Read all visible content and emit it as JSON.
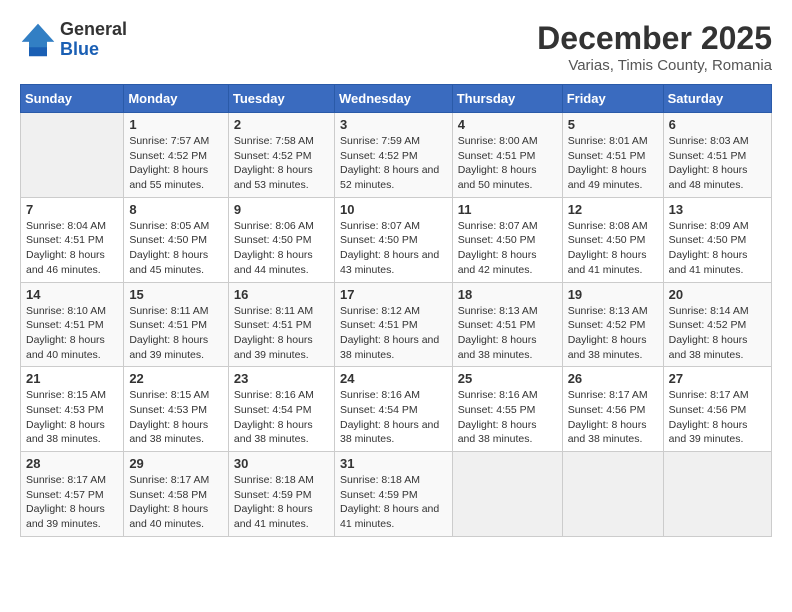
{
  "header": {
    "logo_line1": "General",
    "logo_line2": "Blue",
    "title": "December 2025",
    "subtitle": "Varias, Timis County, Romania"
  },
  "days_of_week": [
    "Sunday",
    "Monday",
    "Tuesday",
    "Wednesday",
    "Thursday",
    "Friday",
    "Saturday"
  ],
  "weeks": [
    [
      {
        "num": "",
        "sunrise": "",
        "sunset": "",
        "daylight": ""
      },
      {
        "num": "1",
        "sunrise": "Sunrise: 7:57 AM",
        "sunset": "Sunset: 4:52 PM",
        "daylight": "Daylight: 8 hours and 55 minutes."
      },
      {
        "num": "2",
        "sunrise": "Sunrise: 7:58 AM",
        "sunset": "Sunset: 4:52 PM",
        "daylight": "Daylight: 8 hours and 53 minutes."
      },
      {
        "num": "3",
        "sunrise": "Sunrise: 7:59 AM",
        "sunset": "Sunset: 4:52 PM",
        "daylight": "Daylight: 8 hours and 52 minutes."
      },
      {
        "num": "4",
        "sunrise": "Sunrise: 8:00 AM",
        "sunset": "Sunset: 4:51 PM",
        "daylight": "Daylight: 8 hours and 50 minutes."
      },
      {
        "num": "5",
        "sunrise": "Sunrise: 8:01 AM",
        "sunset": "Sunset: 4:51 PM",
        "daylight": "Daylight: 8 hours and 49 minutes."
      },
      {
        "num": "6",
        "sunrise": "Sunrise: 8:03 AM",
        "sunset": "Sunset: 4:51 PM",
        "daylight": "Daylight: 8 hours and 48 minutes."
      }
    ],
    [
      {
        "num": "7",
        "sunrise": "Sunrise: 8:04 AM",
        "sunset": "Sunset: 4:51 PM",
        "daylight": "Daylight: 8 hours and 46 minutes."
      },
      {
        "num": "8",
        "sunrise": "Sunrise: 8:05 AM",
        "sunset": "Sunset: 4:50 PM",
        "daylight": "Daylight: 8 hours and 45 minutes."
      },
      {
        "num": "9",
        "sunrise": "Sunrise: 8:06 AM",
        "sunset": "Sunset: 4:50 PM",
        "daylight": "Daylight: 8 hours and 44 minutes."
      },
      {
        "num": "10",
        "sunrise": "Sunrise: 8:07 AM",
        "sunset": "Sunset: 4:50 PM",
        "daylight": "Daylight: 8 hours and 43 minutes."
      },
      {
        "num": "11",
        "sunrise": "Sunrise: 8:07 AM",
        "sunset": "Sunset: 4:50 PM",
        "daylight": "Daylight: 8 hours and 42 minutes."
      },
      {
        "num": "12",
        "sunrise": "Sunrise: 8:08 AM",
        "sunset": "Sunset: 4:50 PM",
        "daylight": "Daylight: 8 hours and 41 minutes."
      },
      {
        "num": "13",
        "sunrise": "Sunrise: 8:09 AM",
        "sunset": "Sunset: 4:50 PM",
        "daylight": "Daylight: 8 hours and 41 minutes."
      }
    ],
    [
      {
        "num": "14",
        "sunrise": "Sunrise: 8:10 AM",
        "sunset": "Sunset: 4:51 PM",
        "daylight": "Daylight: 8 hours and 40 minutes."
      },
      {
        "num": "15",
        "sunrise": "Sunrise: 8:11 AM",
        "sunset": "Sunset: 4:51 PM",
        "daylight": "Daylight: 8 hours and 39 minutes."
      },
      {
        "num": "16",
        "sunrise": "Sunrise: 8:11 AM",
        "sunset": "Sunset: 4:51 PM",
        "daylight": "Daylight: 8 hours and 39 minutes."
      },
      {
        "num": "17",
        "sunrise": "Sunrise: 8:12 AM",
        "sunset": "Sunset: 4:51 PM",
        "daylight": "Daylight: 8 hours and 38 minutes."
      },
      {
        "num": "18",
        "sunrise": "Sunrise: 8:13 AM",
        "sunset": "Sunset: 4:51 PM",
        "daylight": "Daylight: 8 hours and 38 minutes."
      },
      {
        "num": "19",
        "sunrise": "Sunrise: 8:13 AM",
        "sunset": "Sunset: 4:52 PM",
        "daylight": "Daylight: 8 hours and 38 minutes."
      },
      {
        "num": "20",
        "sunrise": "Sunrise: 8:14 AM",
        "sunset": "Sunset: 4:52 PM",
        "daylight": "Daylight: 8 hours and 38 minutes."
      }
    ],
    [
      {
        "num": "21",
        "sunrise": "Sunrise: 8:15 AM",
        "sunset": "Sunset: 4:53 PM",
        "daylight": "Daylight: 8 hours and 38 minutes."
      },
      {
        "num": "22",
        "sunrise": "Sunrise: 8:15 AM",
        "sunset": "Sunset: 4:53 PM",
        "daylight": "Daylight: 8 hours and 38 minutes."
      },
      {
        "num": "23",
        "sunrise": "Sunrise: 8:16 AM",
        "sunset": "Sunset: 4:54 PM",
        "daylight": "Daylight: 8 hours and 38 minutes."
      },
      {
        "num": "24",
        "sunrise": "Sunrise: 8:16 AM",
        "sunset": "Sunset: 4:54 PM",
        "daylight": "Daylight: 8 hours and 38 minutes."
      },
      {
        "num": "25",
        "sunrise": "Sunrise: 8:16 AM",
        "sunset": "Sunset: 4:55 PM",
        "daylight": "Daylight: 8 hours and 38 minutes."
      },
      {
        "num": "26",
        "sunrise": "Sunrise: 8:17 AM",
        "sunset": "Sunset: 4:56 PM",
        "daylight": "Daylight: 8 hours and 38 minutes."
      },
      {
        "num": "27",
        "sunrise": "Sunrise: 8:17 AM",
        "sunset": "Sunset: 4:56 PM",
        "daylight": "Daylight: 8 hours and 39 minutes."
      }
    ],
    [
      {
        "num": "28",
        "sunrise": "Sunrise: 8:17 AM",
        "sunset": "Sunset: 4:57 PM",
        "daylight": "Daylight: 8 hours and 39 minutes."
      },
      {
        "num": "29",
        "sunrise": "Sunrise: 8:17 AM",
        "sunset": "Sunset: 4:58 PM",
        "daylight": "Daylight: 8 hours and 40 minutes."
      },
      {
        "num": "30",
        "sunrise": "Sunrise: 8:18 AM",
        "sunset": "Sunset: 4:59 PM",
        "daylight": "Daylight: 8 hours and 41 minutes."
      },
      {
        "num": "31",
        "sunrise": "Sunrise: 8:18 AM",
        "sunset": "Sunset: 4:59 PM",
        "daylight": "Daylight: 8 hours and 41 minutes."
      },
      {
        "num": "",
        "sunrise": "",
        "sunset": "",
        "daylight": ""
      },
      {
        "num": "",
        "sunrise": "",
        "sunset": "",
        "daylight": ""
      },
      {
        "num": "",
        "sunrise": "",
        "sunset": "",
        "daylight": ""
      }
    ]
  ]
}
